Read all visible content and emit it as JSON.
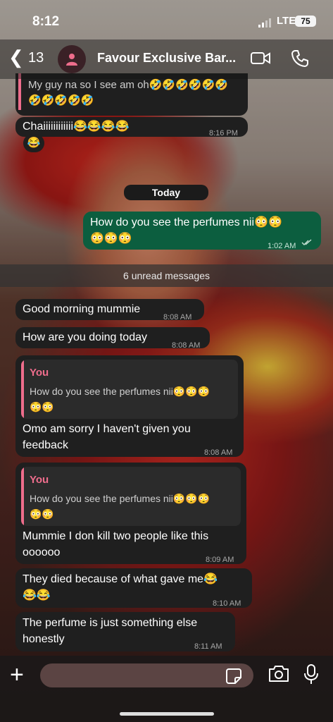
{
  "status_bar": {
    "time": "8:12",
    "network": "LTE",
    "battery": "75"
  },
  "header": {
    "back_count": "13",
    "contact_name": "Favour Exclusive Bar..."
  },
  "top_partial": {
    "text_line1": "My guy na so I see am oh🤣🤣🤣🤣🤣🤣",
    "text_line2": "🤣🤣🤣🤣🤣"
  },
  "messages_before": [
    {
      "text": "Chaiiiiiiiiiiii😂😂😂😂",
      "time": "8:16 PM",
      "reaction": "😂"
    }
  ],
  "date_chip": "Today",
  "outgoing": {
    "text_line1": "How do you see the perfumes nii😳😳",
    "text_line2": "😳😳😳",
    "time": "1:02 AM"
  },
  "unread_banner": "6 unread messages",
  "messages": [
    {
      "text": "Good morning mummie",
      "time": "8:08 AM"
    },
    {
      "text": "How are you doing today",
      "time": "8:08 AM"
    },
    {
      "quote_author": "You",
      "quote_line1": "How do you see the perfumes nii😳😳😳",
      "quote_line2": "😳😳",
      "text_line1": "Omo am sorry I haven't given you",
      "text_line2": "feedback",
      "time": "8:08 AM"
    },
    {
      "quote_author": "You",
      "quote_line1": "How do you see the perfumes nii😳😳😳",
      "quote_line2": "😳😳",
      "text_line1": "Mummie I don kill two people like this",
      "text_line2": "oooooo",
      "time": "8:09 AM"
    },
    {
      "text_line1": "They died because of what gave me😂",
      "text_line2": "😂😂",
      "time": "8:10 AM"
    },
    {
      "text_line1": "The perfume is just something else",
      "text_line2": "honestly",
      "time": "8:11 AM"
    }
  ],
  "icons": [
    "back-chevron-icon",
    "person-icon",
    "video-call-icon",
    "phone-icon",
    "plus-icon",
    "sticker-icon",
    "camera-icon",
    "microphone-icon"
  ]
}
